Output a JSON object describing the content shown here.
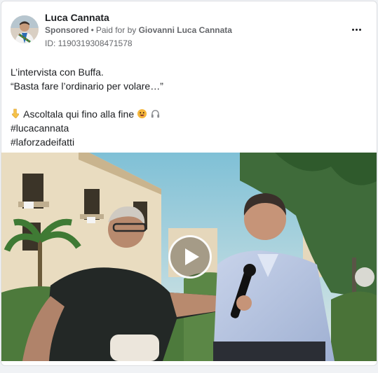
{
  "post": {
    "author": "Luca Cannata",
    "sponsored": "Sponsored",
    "separator": "•",
    "paid_for_prefix": "Paid for by",
    "paid_for_by": "Giovanni Luca Cannata",
    "id_line": "ID: 1190319308471578",
    "lines": {
      "l1": "L’intervista con Buffa.",
      "l2": "“Basta fare l’ordinario per volare…”",
      "l3": "Ascoltala qui fino alla fine",
      "l4": "#lucacannata",
      "l5": "#laforzadeifatti"
    }
  },
  "icons": {
    "more": "more-options-icon",
    "pointing": "pointing-down-emoji",
    "grin": "face-emoji",
    "headphones": "headphones-emoji",
    "play": "play-icon"
  },
  "colors": {
    "text": "#1c1e21",
    "secondary": "#65676b",
    "border": "#dddfe2"
  }
}
